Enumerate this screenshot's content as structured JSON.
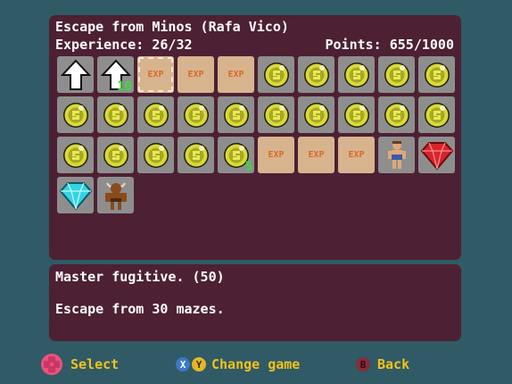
{
  "achievement": {
    "title": "Escape from Minos (Rafa Vico)",
    "experience": "Experience: 26/32",
    "points": "Points: 655/1000"
  },
  "grid": [
    {
      "kind": "arrow-up",
      "icon": "arrow-up-icon"
    },
    {
      "kind": "arrow-up",
      "icon": "arrow-up-icon",
      "badge": "10"
    },
    {
      "kind": "exp",
      "label": "EXP",
      "selected": true
    },
    {
      "kind": "exp",
      "label": "EXP"
    },
    {
      "kind": "exp",
      "label": "EXP"
    },
    {
      "kind": "coin",
      "icon": "gold-coin-icon"
    },
    {
      "kind": "coin",
      "icon": "gold-coin-icon"
    },
    {
      "kind": "coin",
      "icon": "gold-coin-icon"
    },
    {
      "kind": "coin",
      "icon": "gold-coin-icon"
    },
    {
      "kind": "coin",
      "icon": "gold-coin-icon"
    },
    {
      "kind": "coin",
      "icon": "gold-coin-icon"
    },
    {
      "kind": "coin",
      "icon": "gold-coin-icon"
    },
    {
      "kind": "coin",
      "icon": "gold-coin-icon"
    },
    {
      "kind": "coin",
      "icon": "gold-coin-icon"
    },
    {
      "kind": "coin",
      "icon": "gold-coin-icon"
    },
    {
      "kind": "coin",
      "icon": "gold-coin-icon"
    },
    {
      "kind": "coin",
      "icon": "gold-coin-icon"
    },
    {
      "kind": "coin",
      "icon": "gold-coin-icon"
    },
    {
      "kind": "coin",
      "icon": "gold-coin-icon"
    },
    {
      "kind": "coin",
      "icon": "gold-coin-icon"
    },
    {
      "kind": "coin",
      "icon": "gold-coin-icon"
    },
    {
      "kind": "coin",
      "icon": "gold-coin-icon"
    },
    {
      "kind": "coin",
      "icon": "gold-coin-icon"
    },
    {
      "kind": "coin",
      "icon": "gold-coin-icon"
    },
    {
      "kind": "coin",
      "icon": "gold-coin-icon",
      "badge": "5"
    },
    {
      "kind": "exp",
      "label": "EXP"
    },
    {
      "kind": "exp",
      "label": "EXP"
    },
    {
      "kind": "exp",
      "label": "EXP"
    },
    {
      "kind": "hero",
      "icon": "hero-character-icon"
    },
    {
      "kind": "ruby",
      "icon": "red-gem-icon"
    },
    {
      "kind": "diamond",
      "icon": "cyan-gem-icon"
    },
    {
      "kind": "minotaur",
      "icon": "minotaur-icon"
    }
  ],
  "description": {
    "title": "Master fugitive. (50)",
    "text": "Escape from 30 mazes."
  },
  "footer": {
    "select": "Select",
    "x_symbol": "X",
    "y_symbol": "Y",
    "change_game": "Change game",
    "b_symbol": "B",
    "back": "Back"
  },
  "colors": {
    "background": "#2f5a66",
    "panel": "#4d2033",
    "tile": "#8e8e8e",
    "exp_tile": "#d8b48e",
    "footer_text": "#f2c219",
    "badge": "#37e037"
  }
}
